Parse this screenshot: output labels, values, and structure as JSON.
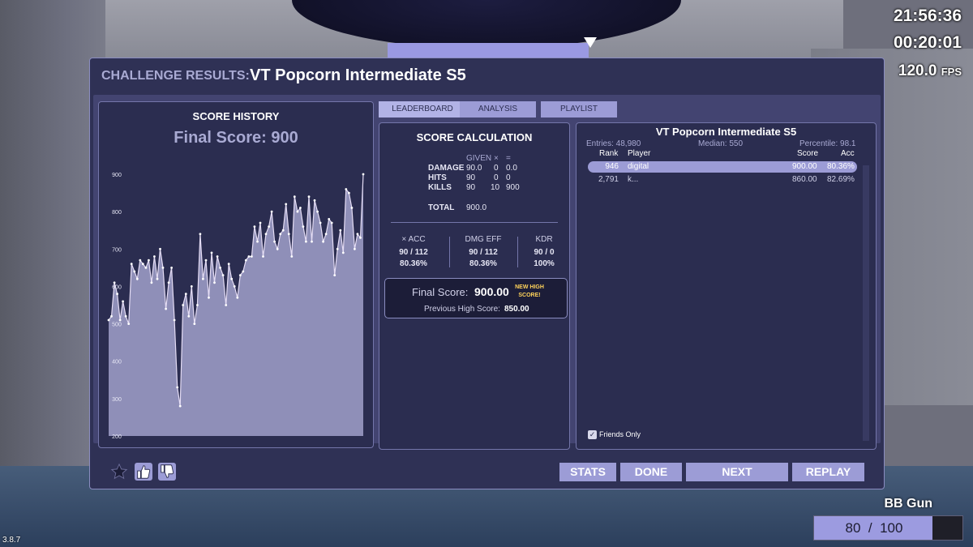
{
  "hud": {
    "clock": "21:56:36",
    "timer": "00:20:01",
    "fps_value": "120.0",
    "fps_unit": "FPS",
    "version": "3.8.7",
    "weapon": "BB Gun",
    "ammo_current": "80",
    "ammo_sep": "/",
    "ammo_max": "100",
    "ammo_fraction": 0.8
  },
  "header": {
    "label": "CHALLENGE RESULTS:",
    "title": "VT Popcorn Intermediate S5"
  },
  "history": {
    "title": "SCORE HISTORY",
    "final_score": "Final Score: 900"
  },
  "tabs": {
    "leaderboard": "LEADERBOARD",
    "analysis": "ANALYSIS",
    "playlist": "PLAYLIST"
  },
  "calc": {
    "title": "SCORE CALCULATION",
    "head_given": "GIVEN",
    "head_times": "×",
    "head_equals": "=",
    "rows": [
      {
        "label": "DAMAGE",
        "given": "90.0",
        "mult": "0",
        "result": "0.0"
      },
      {
        "label": "HITS",
        "given": "90",
        "mult": "0",
        "result": "0"
      },
      {
        "label": "KILLS",
        "given": "90",
        "mult": "10",
        "result": "900"
      }
    ],
    "total_label": "TOTAL",
    "total_value": "900.0",
    "stats": [
      {
        "label": "× ACC",
        "ratio": "90 / 112",
        "pct": "80.36%"
      },
      {
        "label": "DMG EFF",
        "ratio": "90 / 112",
        "pct": "80.36%"
      },
      {
        "label": "KDR",
        "ratio": "90 / 0",
        "pct": "100%"
      }
    ],
    "final_label": "Final Score:",
    "final_value": "900.00",
    "new_high_1": "NEW HIGH",
    "new_high_2": "SCORE!",
    "prev_label": "Previous High Score:",
    "prev_value": "850.00"
  },
  "leaderboard": {
    "title": "VT Popcorn Intermediate S5",
    "entries": "Entries: 48,980",
    "median": "Median: 550",
    "percentile": "Percentile: 98.1",
    "col_rank": "Rank",
    "col_player": "Player",
    "col_score": "Score",
    "col_acc": "Acc",
    "rows": [
      {
        "rank": "946",
        "player": "digital",
        "score": "900.00",
        "acc": "80.36%"
      },
      {
        "rank": "2,791",
        "player": "k...",
        "score": "860.00",
        "acc": "82.69%"
      }
    ],
    "friends_only": "Friends Only"
  },
  "footer": {
    "stats": "STATS",
    "done": "DONE",
    "next": "NEXT",
    "replay": "REPLAY"
  },
  "colors": {
    "panel": "#2f3155",
    "accent": "#9c9cd6",
    "highlight": "#ffd35a"
  },
  "chart_data": {
    "type": "area",
    "title": "SCORE HISTORY",
    "ylim": [
      200,
      900
    ],
    "yticks": [
      200,
      300,
      400,
      500,
      600,
      700,
      800,
      900
    ],
    "values": [
      510,
      520,
      610,
      580,
      510,
      560,
      520,
      500,
      660,
      640,
      620,
      670,
      660,
      650,
      670,
      610,
      680,
      620,
      700,
      650,
      540,
      610,
      650,
      510,
      330,
      280,
      550,
      580,
      520,
      600,
      500,
      550,
      740,
      620,
      670,
      570,
      690,
      610,
      680,
      650,
      630,
      550,
      660,
      620,
      600,
      570,
      630,
      640,
      670,
      680,
      680,
      760,
      720,
      770,
      680,
      740,
      760,
      800,
      720,
      700,
      740,
      750,
      820,
      740,
      680,
      840,
      800,
      810,
      760,
      720,
      840,
      720,
      830,
      800,
      770,
      720,
      740,
      780,
      770,
      630,
      700,
      750,
      690,
      860,
      850,
      810,
      700,
      740,
      730,
      900
    ]
  }
}
